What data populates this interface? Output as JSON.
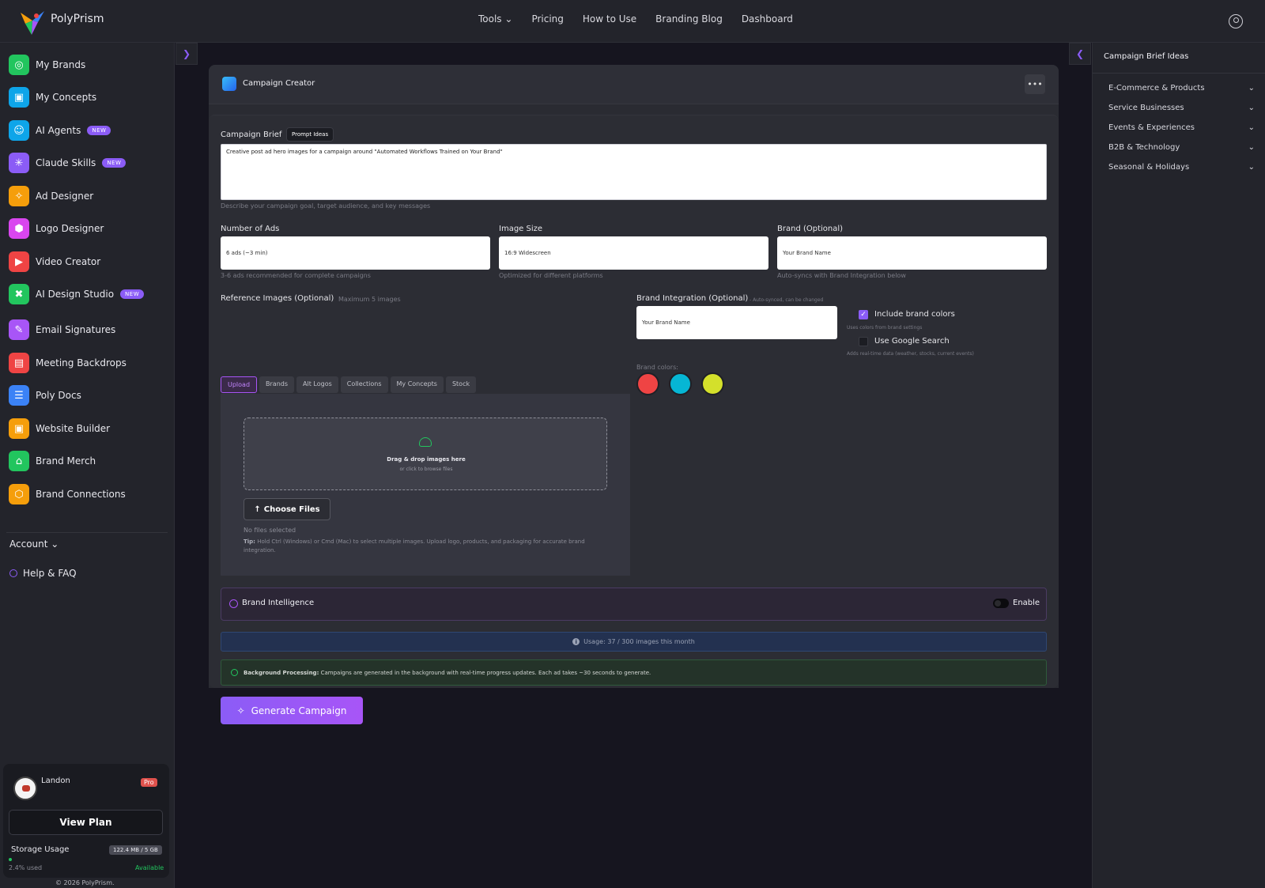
{
  "app": {
    "name": "PolyPrism"
  },
  "nav": {
    "tools": "Tools ⌄",
    "pricing": "Pricing",
    "how_to_use": "How to Use",
    "blog": "Branding Blog",
    "dashboard": "Dashboard"
  },
  "sidebar": {
    "items": [
      {
        "label": "My Brands",
        "icon": "fingerprint-icon",
        "color": "#22c55e",
        "glyph": "◎",
        "new": false
      },
      {
        "label": "My Concepts",
        "icon": "images-icon",
        "color": "#0ea5e9",
        "glyph": "▣",
        "new": false
      },
      {
        "label": "AI Agents",
        "icon": "agents-icon",
        "color": "#0ea5e9",
        "glyph": "☺",
        "new": true
      },
      {
        "label": "Claude Skills",
        "icon": "sparkle-icon",
        "color": "#8b5cf6",
        "glyph": "✳",
        "new": true
      },
      {
        "label": "Ad Designer",
        "icon": "wand-icon",
        "color": "#f59e0b",
        "glyph": "✧",
        "new": false
      },
      {
        "label": "Logo Designer",
        "icon": "hexagon-icon",
        "color": "#d946ef",
        "glyph": "⬢",
        "new": false
      },
      {
        "label": "Video Creator",
        "icon": "video-icon",
        "color": "#ef4444",
        "glyph": "▶",
        "new": false
      },
      {
        "label": "AI Design Studio",
        "icon": "design-studio-icon",
        "color": "#22c55e",
        "glyph": "✖",
        "new": true
      },
      {
        "label": "Email Signatures",
        "icon": "signature-icon",
        "color": "#a855f7",
        "glyph": "✎",
        "new": false
      },
      {
        "label": "Meeting Backdrops",
        "icon": "backdrop-icon",
        "color": "#ef4444",
        "glyph": "▤",
        "new": false
      },
      {
        "label": "Poly Docs",
        "icon": "docs-icon",
        "color": "#3b82f6",
        "glyph": "☰",
        "new": false
      },
      {
        "label": "Website Builder",
        "icon": "browser-icon",
        "color": "#f59e0b",
        "glyph": "▣",
        "new": false
      },
      {
        "label": "Brand Merch",
        "icon": "shirt-icon",
        "color": "#22c55e",
        "glyph": "⌂",
        "new": false
      },
      {
        "label": "Brand Connections",
        "icon": "connections-icon",
        "color": "#f59e0b",
        "glyph": "⬡",
        "new": false
      }
    ],
    "new_badge": "NEW",
    "account": "Account ⌄",
    "help": "Help & FAQ",
    "user": {
      "name": "Landon",
      "tier": "Pro",
      "view_plan": "View Plan",
      "storage_label": "Storage Usage",
      "storage_value": "122.4 MB / 5 GB",
      "storage_used": "2.4% used",
      "storage_available": "Available"
    },
    "copyright": "© 2026 PolyPrism."
  },
  "right_sidebar": {
    "title": "Campaign Brief Ideas",
    "items": [
      "E-Commerce & Products",
      "Service Businesses",
      "Events & Experiences",
      "B2B & Technology",
      "Seasonal & Holidays"
    ]
  },
  "panel": {
    "title": "Campaign Creator",
    "more": "•••",
    "brief_label": "Campaign Brief",
    "prompt_ideas": "Prompt Ideas",
    "brief_value": "Creative post ad hero images for a campaign around \"Automated Workflows Trained on Your Brand\"",
    "brief_hint": "Describe your campaign goal, target audience, and key messages",
    "num_ads_label": "Number of Ads",
    "num_ads_value": "6 ads (~3 min)",
    "num_ads_hint": "3-6 ads recommended for complete campaigns",
    "image_size_label": "Image Size",
    "image_size_value": "16:9 Widescreen",
    "image_size_hint": "Optimized for different platforms",
    "brand_label": "Brand (Optional)",
    "brand_value": "Your Brand Name",
    "brand_hint": "Auto-syncs with Brand Integration below",
    "ref_label": "Reference Images (Optional)",
    "ref_max": "Maximum 5 images",
    "tabs": [
      "Upload",
      "Brands",
      "Alt Logos",
      "Collections",
      "My Concepts",
      "Stock"
    ],
    "drop_main": "Drag & drop images here",
    "drop_sub": "or click to browse files",
    "choose_files": "Choose Files",
    "no_files": "No files selected",
    "tip_label": "Tip:",
    "tip_text": " Hold Ctrl (Windows) or Cmd (Mac) to select multiple images. Upload logo, products, and packaging for accurate brand integration.",
    "integration_label": "Brand Integration (Optional)",
    "integration_hint": "- Auto-synced, can be changed",
    "integration_value": "Your Brand Name",
    "include_colors": "Include brand colors",
    "include_colors_hint": "Uses colors from brand settings",
    "include_colors_checked": true,
    "google_search": "Use Google Search",
    "google_search_hint": "Adds real-time data (weather, stocks, current events)",
    "google_search_checked": false,
    "brand_colors_label": "Brand colors:",
    "brand_colors": [
      "#ef4444",
      "#06b6d4",
      "#d4e02b"
    ],
    "intelligence_title": "Brand Intelligence",
    "intelligence_enable": "Enable",
    "usage": "Usage: 37 / 300 images this month",
    "bg_label": "Background Processing:",
    "bg_text": " Campaigns are generated in the background with real-time progress updates. Each ad takes ~30 seconds to generate.",
    "generate": "Generate Campaign"
  }
}
